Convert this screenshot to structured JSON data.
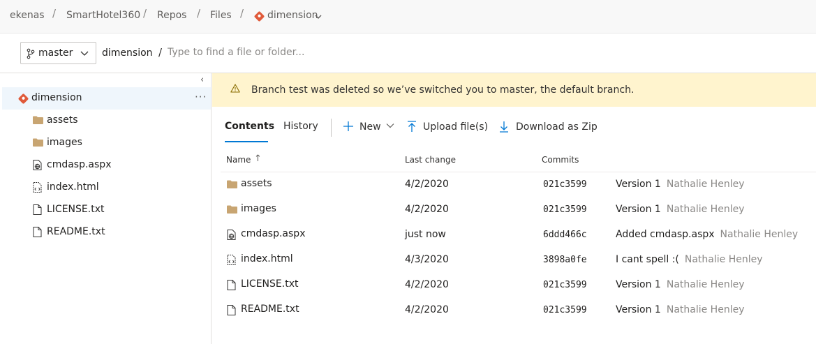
{
  "breadcrumb": {
    "items": [
      "ekenas",
      "SmartHotel360",
      "Repos",
      "Files",
      "dimension"
    ],
    "separator": "/"
  },
  "toolbar": {
    "branch": "master",
    "path_root": "dimension",
    "path_separator": "/",
    "path_placeholder": "Type to find a file or folder..."
  },
  "tree": {
    "collapse_glyph": "‹",
    "root": "dimension",
    "more_glyph": "···",
    "items": [
      {
        "label": "assets",
        "icon": "folder-icon"
      },
      {
        "label": "images",
        "icon": "folder-icon"
      },
      {
        "label": "cmdasp.aspx",
        "icon": "web-file-icon"
      },
      {
        "label": "index.html",
        "icon": "code-file-icon"
      },
      {
        "label": "LICENSE.txt",
        "icon": "file-icon"
      },
      {
        "label": "README.txt",
        "icon": "file-icon"
      }
    ]
  },
  "banner": {
    "text": "Branch test was deleted so we’ve switched you to master, the default branch.",
    "icon": "warning-icon"
  },
  "tabs": {
    "contents": "Contents",
    "history": "History"
  },
  "commands": {
    "new": "New",
    "upload": "Upload file(s)",
    "download": "Download as Zip"
  },
  "table": {
    "columns": {
      "name": "Name",
      "sort_glyph": "↑",
      "last_change": "Last change",
      "commits": "Commits"
    },
    "rows": [
      {
        "name": "assets",
        "icon": "folder-icon",
        "last_change": "4/2/2020",
        "commit": "021c3599",
        "message": "Version 1",
        "author": "Nathalie Henley"
      },
      {
        "name": "images",
        "icon": "folder-icon",
        "last_change": "4/2/2020",
        "commit": "021c3599",
        "message": "Version 1",
        "author": "Nathalie Henley"
      },
      {
        "name": "cmdasp.aspx",
        "icon": "web-file-icon",
        "last_change": "just now",
        "commit": "6ddd466c",
        "message": "Added cmdasp.aspx",
        "author": "Nathalie Henley"
      },
      {
        "name": "index.html",
        "icon": "code-file-icon",
        "last_change": "4/3/2020",
        "commit": "3898a0fe",
        "message": "I cant spell :(",
        "author": "Nathalie Henley"
      },
      {
        "name": "LICENSE.txt",
        "icon": "file-icon",
        "last_change": "4/2/2020",
        "commit": "021c3599",
        "message": "Version 1",
        "author": "Nathalie Henley"
      },
      {
        "name": "README.txt",
        "icon": "file-icon",
        "last_change": "4/2/2020",
        "commit": "021c3599",
        "message": "Version 1",
        "author": "Nathalie Henley"
      }
    ]
  },
  "colors": {
    "accent": "#0078d4",
    "git": "#e05a3a",
    "folder": "#c8a572",
    "banner_bg": "#fff4ce",
    "selected_bg": "#eff6fc"
  }
}
